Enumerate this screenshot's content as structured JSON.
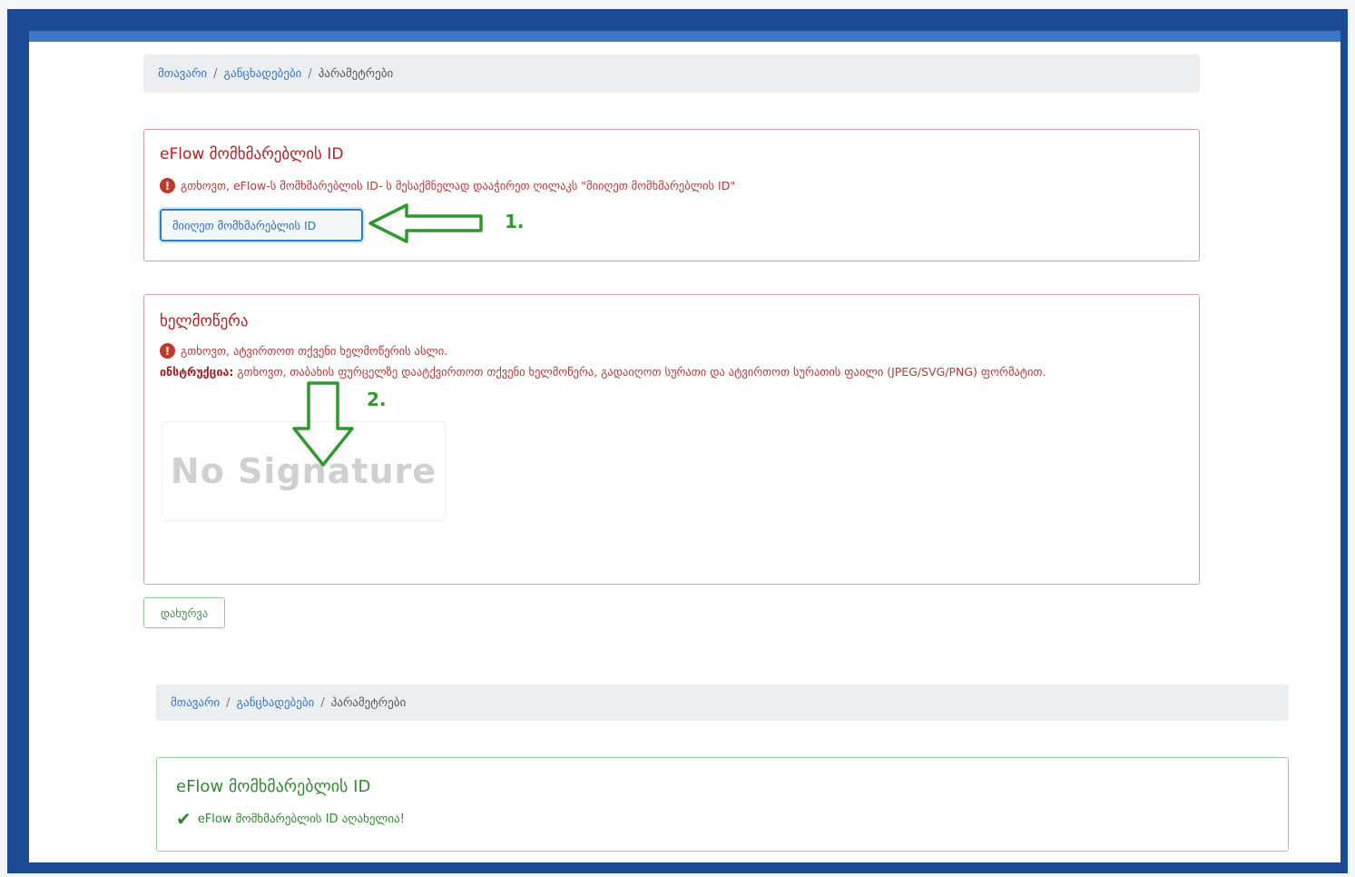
{
  "breadcrumb_top": {
    "home": "მთავარი",
    "applications": "განცხადებები",
    "current": "პარამეტრები",
    "sep": "/"
  },
  "eflow_box": {
    "title": "eFlow მომხმარებლის ID",
    "error_text": "გთხოვთ, eFlow-ს მომხმარებლის ID- ს მესაქმნელად დააჭირეთ ღილაკს \"მიიღეთ მომხმარებლის ID\"",
    "button_label": "მიიღეთ მომხმარებლის ID",
    "annotation": "1."
  },
  "signature_box": {
    "title": "ხელმოწერა",
    "error_text": "გთხოვთ, ატვირთოთ თქვენი ხელმოწერის ასლი.",
    "instruction_label": "ინსტრუქცია:",
    "instruction_text": "გთხოვთ, თაბახის ფურცელზე დაატქვირთოთ თქვენი ხელმოწერა, გადაიღოთ სურათი და ატვირთოთ სურათის ფაილი (JPEG/SVG/PNG) ფორმატით.",
    "placeholder": "No Signature",
    "annotation": "2."
  },
  "close_button": "დახურვა",
  "breadcrumb_bottom": {
    "home": "მთავარი",
    "applications": "განცხადებები",
    "current": "პარამეტრები",
    "sep": "/"
  },
  "eflow_success": {
    "title": "eFlow მომხმარებლის ID",
    "success_text": "eFlow მომხმარებლის ID აღახელია!"
  },
  "colors": {
    "frame": "#1c4a96",
    "error": "#b22222",
    "success": "#2f8a2f",
    "annotation": "#2e9a2e",
    "link": "#3576c2"
  }
}
